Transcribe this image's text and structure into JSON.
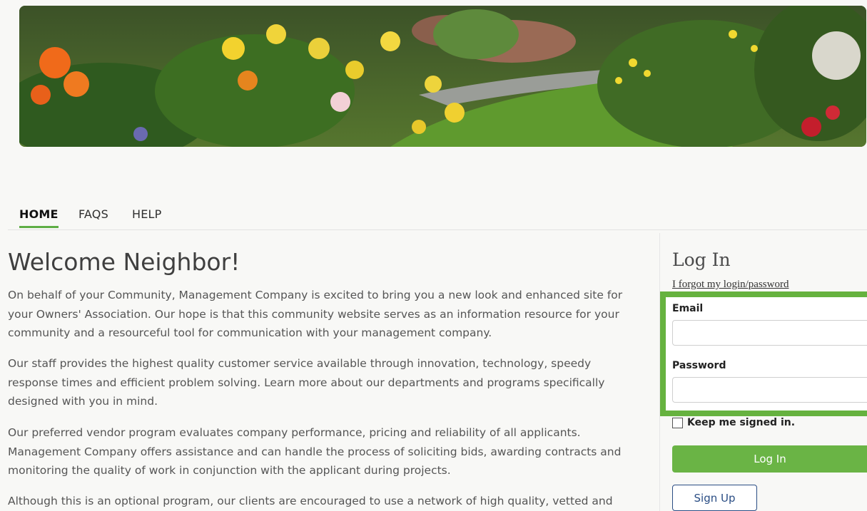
{
  "banner": {
    "image_desc_icon": "garden-banner-image"
  },
  "nav": {
    "items": [
      {
        "label": "HOME",
        "active": true
      },
      {
        "label": "FAQS",
        "active": false
      },
      {
        "label": "HELP",
        "active": false
      }
    ]
  },
  "main": {
    "title": "Welcome Neighbor!",
    "paragraphs": [
      "On behalf of your Community, Management Company is excited to bring you a new look and enhanced site for your Owners' Association. Our hope is that this community website serves as an information resource for your community and a resourceful tool for communication with your management company.",
      "Our staff provides the highest quality customer service available through innovation, technology, speedy response times and efficient problem solving. Learn more about our departments and programs specifically designed with you in mind.",
      "Our preferred vendor program evaluates company performance, pricing and reliability of all applicants. Management Company offers assistance and can handle the process of soliciting bids, awarding contracts and monitoring the quality of work in conjunction with the applicant during projects.",
      "Although this is an optional program, our clients are encouraged to use a network of high quality, vetted and"
    ]
  },
  "login": {
    "title": "Log In",
    "forgot_link": "I forgot my login/password",
    "email_label": "Email",
    "email_value": "",
    "password_label": "Password",
    "password_value": "",
    "keep_signed_in": "Keep me signed in.",
    "login_button": "Log In",
    "signup_button": "Sign Up"
  },
  "colors": {
    "accent_green": "#66b23f",
    "button_green": "#6ab445",
    "signup_blue": "#2a4d84"
  }
}
